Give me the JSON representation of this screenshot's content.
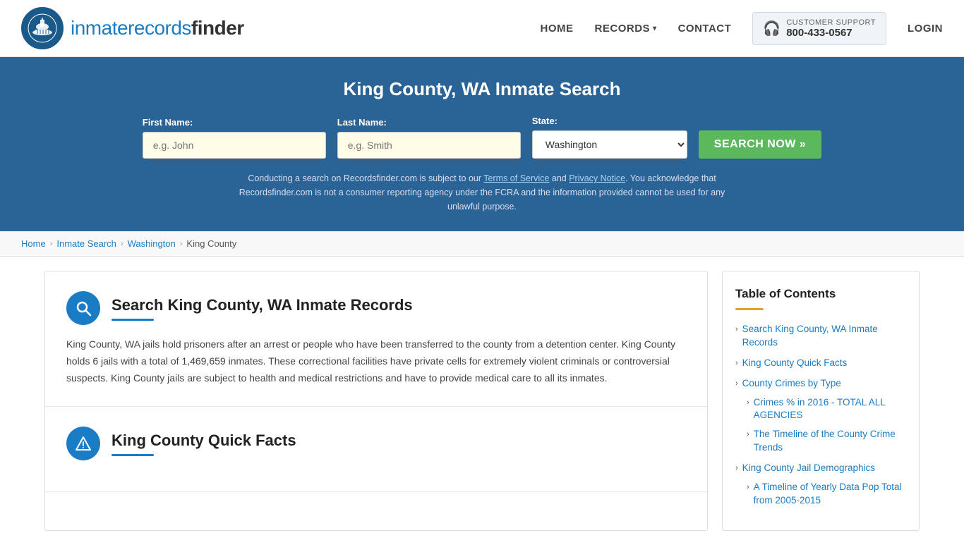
{
  "header": {
    "logo_text_part1": "inmaterecords",
    "logo_text_part2": "finder",
    "nav": {
      "home": "HOME",
      "records": "RECORDS",
      "contact": "CONTACT",
      "support_label": "CUSTOMER SUPPORT",
      "support_number": "800-433-0567",
      "login": "LOGIN"
    }
  },
  "hero": {
    "title": "King County, WA Inmate Search",
    "form": {
      "first_name_label": "First Name:",
      "first_name_placeholder": "e.g. John",
      "last_name_label": "Last Name:",
      "last_name_placeholder": "e.g. Smith",
      "state_label": "State:",
      "state_value": "Washington",
      "search_button": "SEARCH NOW »"
    },
    "disclaimer": "Conducting a search on Recordsfinder.com is subject to our Terms of Service and Privacy Notice. You acknowledge that Recordsfinder.com is not a consumer reporting agency under the FCRA and the information provided cannot be used for any unlawful purpose."
  },
  "breadcrumb": {
    "home": "Home",
    "inmate_search": "Inmate Search",
    "washington": "Washington",
    "king_county": "King County"
  },
  "content": {
    "section1": {
      "title": "Search King County, WA Inmate Records",
      "body": "King County, WA jails hold prisoners after an arrest or people who have been transferred to the county from a detention center. King County holds 6 jails with a total of 1,469,659 inmates. These correctional facilities have private cells for extremely violent criminals or controversial suspects. King County jails are subject to health and medical restrictions and have to provide medical care to all its inmates."
    },
    "section2": {
      "title": "King County Quick Facts"
    }
  },
  "sidebar": {
    "toc_title": "Table of Contents",
    "items": [
      {
        "label": "Search King County, WA Inmate Records",
        "sub": false
      },
      {
        "label": "King County Quick Facts",
        "sub": false
      },
      {
        "label": "County Crimes by Type",
        "sub": false
      },
      {
        "label": "Crimes % in 2016 - TOTAL ALL AGENCIES",
        "sub": true
      },
      {
        "label": "The Timeline of the County Crime Trends",
        "sub": true
      },
      {
        "label": "King County Jail Demographics",
        "sub": false
      },
      {
        "label": "A Timeline of Yearly Data Pop Total from 2005-2015",
        "sub": true
      }
    ]
  }
}
